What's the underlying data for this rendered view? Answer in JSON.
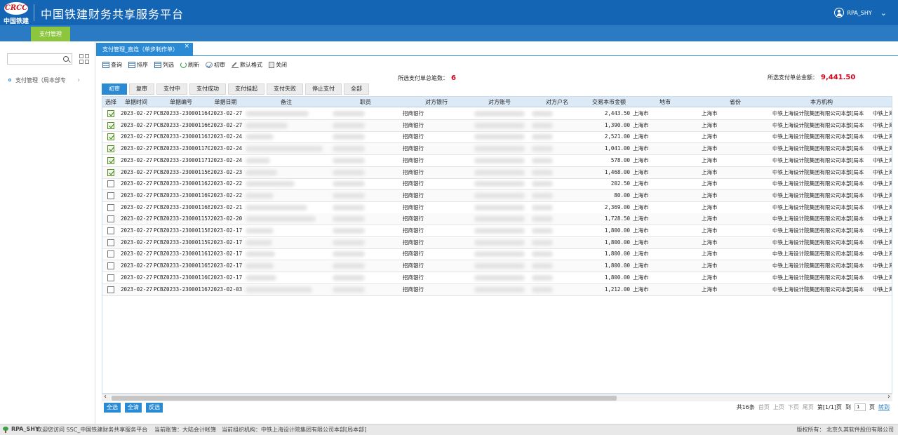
{
  "header": {
    "logo_mark": "CRCC",
    "logo_text": "中国铁建",
    "title": "中国铁建财务共享服务平台",
    "user": "RPA_SHY"
  },
  "topnav": {
    "tab": "支付管理"
  },
  "sidebar": {
    "item": "支付管理（局本部专"
  },
  "doc_tab": {
    "label": "支付管理_直连（单步制作单）",
    "close": "×"
  },
  "toolbar": [
    "查询",
    "排序",
    "列选",
    "刷新",
    "初审",
    "默认格式",
    "关闭"
  ],
  "summary": {
    "count_label": "所选支付单总笔数：",
    "count_value": "6",
    "amount_label": "所选支付单总金额：",
    "amount_value": "9,441.50"
  },
  "filter_tabs": [
    "初审",
    "复审",
    "支付中",
    "支付成功",
    "支付挂起",
    "支付失败",
    "停止支付",
    "全部"
  ],
  "table": {
    "columns": [
      "选择",
      "单据时间",
      "单据编号",
      "单据日期",
      "备注",
      "职员",
      "对方银行",
      "对方账号",
      "对方户名",
      "交易本币金额",
      "地市",
      "省份",
      "本方机构"
    ],
    "rows": [
      {
        "checked": true,
        "time": "2023-02-27",
        "no": "PCBZ0233-230001164",
        "date": "2023-02-27",
        "bank": "招商银行",
        "amount": "2,443.50",
        "city": "上海市",
        "province": "上海市",
        "org": "中铁上海设计院集团有限公司本部[局本",
        "org2": "中铁上海"
      },
      {
        "checked": true,
        "time": "2023-02-27",
        "no": "PCBZ0233-230001166",
        "date": "2023-02-27",
        "bank": "招商银行",
        "amount": "1,390.00",
        "city": "上海市",
        "province": "上海市",
        "org": "中铁上海设计院集团有限公司本部[局本",
        "org2": "中铁上海"
      },
      {
        "checked": true,
        "time": "2023-02-27",
        "no": "PCBZ0233-230001163",
        "date": "2023-02-24",
        "bank": "招商银行",
        "amount": "2,521.00",
        "city": "上海市",
        "province": "上海市",
        "org": "中铁上海设计院集团有限公司本部[局本",
        "org2": "中铁上海"
      },
      {
        "checked": true,
        "time": "2023-02-27",
        "no": "PCBZ0233-230001170",
        "date": "2023-02-24",
        "bank": "招商银行",
        "amount": "1,041.00",
        "city": "上海市",
        "province": "上海市",
        "org": "中铁上海设计院集团有限公司本部[局本",
        "org2": "中铁上海"
      },
      {
        "checked": true,
        "time": "2023-02-27",
        "no": "PCBZ0233-230001171",
        "date": "2023-02-24",
        "bank": "招商银行",
        "amount": "578.00",
        "city": "上海市",
        "province": "上海市",
        "org": "中铁上海设计院集团有限公司本部[局本",
        "org2": "中铁上海"
      },
      {
        "checked": true,
        "time": "2023-02-27",
        "no": "PCBZ0233-230001156",
        "date": "2023-02-23",
        "bank": "招商银行",
        "amount": "1,468.00",
        "city": "上海市",
        "province": "上海市",
        "org": "中铁上海设计院集团有限公司本部[局本",
        "org2": "中铁上海"
      },
      {
        "checked": false,
        "time": "2023-02-27",
        "no": "PCBZ0233-230001162",
        "date": "2023-02-22",
        "bank": "招商银行",
        "amount": "202.50",
        "city": "上海市",
        "province": "上海市",
        "org": "中铁上海设计院集团有限公司本部[局本",
        "org2": "中铁上海"
      },
      {
        "checked": false,
        "time": "2023-02-27",
        "no": "PCBZ0233-230001169",
        "date": "2023-02-22",
        "bank": "招商银行",
        "amount": "80.00",
        "city": "上海市",
        "province": "上海市",
        "org": "中铁上海设计院集团有限公司本部[局本",
        "org2": "中铁上海"
      },
      {
        "checked": false,
        "time": "2023-02-27",
        "no": "PCBZ0233-230001168",
        "date": "2023-02-21",
        "bank": "招商银行",
        "amount": "2,369.00",
        "city": "上海市",
        "province": "上海市",
        "org": "中铁上海设计院集团有限公司本部[局本",
        "org2": "中铁上海"
      },
      {
        "checked": false,
        "time": "2023-02-27",
        "no": "PCBZ0233-230001157",
        "date": "2023-02-20",
        "bank": "招商银行",
        "amount": "1,728.50",
        "city": "上海市",
        "province": "上海市",
        "org": "中铁上海设计院集团有限公司本部[局本",
        "org2": "中铁上海"
      },
      {
        "checked": false,
        "time": "2023-02-27",
        "no": "PCBZ0233-230001158",
        "date": "2023-02-17",
        "bank": "招商银行",
        "amount": "1,800.00",
        "city": "上海市",
        "province": "上海市",
        "org": "中铁上海设计院集团有限公司本部[局本",
        "org2": "中铁上海"
      },
      {
        "checked": false,
        "time": "2023-02-27",
        "no": "PCBZ0233-230001159",
        "date": "2023-02-17",
        "bank": "招商银行",
        "amount": "1,800.00",
        "city": "上海市",
        "province": "上海市",
        "org": "中铁上海设计院集团有限公司本部[局本",
        "org2": "中铁上海"
      },
      {
        "checked": false,
        "time": "2023-02-27",
        "no": "PCBZ0233-230001161",
        "date": "2023-02-17",
        "bank": "招商银行",
        "amount": "1,800.00",
        "city": "上海市",
        "province": "上海市",
        "org": "中铁上海设计院集团有限公司本部[局本",
        "org2": "中铁上海"
      },
      {
        "checked": false,
        "time": "2023-02-27",
        "no": "PCBZ0233-230001165",
        "date": "2023-02-17",
        "bank": "招商银行",
        "amount": "1,800.00",
        "city": "上海市",
        "province": "上海市",
        "org": "中铁上海设计院集团有限公司本部[局本",
        "org2": "中铁上海"
      },
      {
        "checked": false,
        "time": "2023-02-27",
        "no": "PCBZ0233-230001160",
        "date": "2023-02-17",
        "bank": "招商银行",
        "amount": "1,800.00",
        "city": "上海市",
        "province": "上海市",
        "org": "中铁上海设计院集团有限公司本部[局本",
        "org2": "中铁上海"
      },
      {
        "checked": false,
        "time": "2023-02-27",
        "no": "PCBZ0233-230001167",
        "date": "2023-02-03",
        "bank": "招商银行",
        "amount": "1,212.00",
        "city": "上海市",
        "province": "上海市",
        "org": "中铁上海设计院集团有限公司本部[局本",
        "org2": "中铁上海"
      }
    ]
  },
  "bottom": {
    "select_all": "全选",
    "clear_all": "全清",
    "invert": "反选",
    "total": "共16条",
    "first": "首页",
    "prev": "上页",
    "next": "下页",
    "last": "尾页",
    "page_info": "第[1/1]页",
    "goto_label": "到",
    "goto_value": "1",
    "page_unit": "页",
    "goto_btn": "转到"
  },
  "statusbar": {
    "user": "RPA_SHY",
    "welcome": "欢迎您访问 SSC_中国铁建财务共享服务平台",
    "ledger": "当前账簿：大陆会计帐簿",
    "org": "当前组织机构：中铁上海设计院集团有限公司本部[局本部]",
    "copyright": "版权所有：  北京久其软件股份有限公司"
  }
}
